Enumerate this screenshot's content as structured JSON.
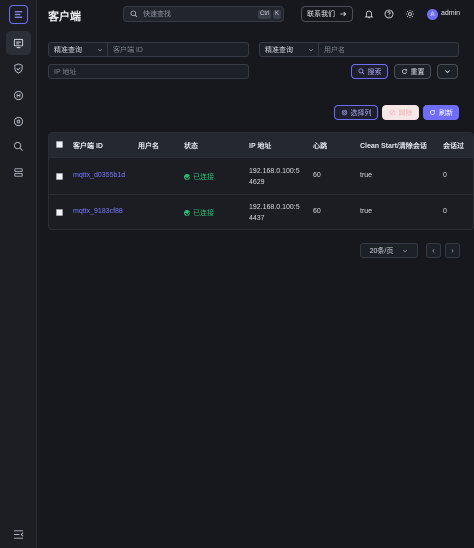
{
  "header": {
    "title": "客户端",
    "search_placeholder": "快速查找",
    "shortcut_key1": "Ctrl",
    "shortcut_key2": "K",
    "contact_label": "联系我们",
    "user_initial": "A",
    "user_name": "admin"
  },
  "filters": {
    "client_mode": "精准查询",
    "client_placeholder": "客户端 ID",
    "user_mode": "精准查询",
    "user_placeholder": "用户名",
    "ip_placeholder": "IP 地址",
    "search_label": "搜索",
    "reset_label": "重置"
  },
  "toolbar": {
    "columns_label": "选择列",
    "clear_label": "踢除",
    "refresh_label": "刷新"
  },
  "table": {
    "columns": [
      "客户端 ID",
      "用户名",
      "状态",
      "IP 地址",
      "心跳",
      "Clean Start/清除会话",
      "会话过"
    ],
    "rows": [
      {
        "client_id": "mqttx_d0355b1d",
        "username": "",
        "status": "已连接",
        "ip_line1": "192.168.0.100:5",
        "ip_line2": "4629",
        "keepalive": "60",
        "clean_start": "true",
        "session": "0"
      },
      {
        "client_id": "mqttx_9183cf88",
        "username": "",
        "status": "已连接",
        "ip_line1": "192.168.0.100:5",
        "ip_line2": "4437",
        "keepalive": "60",
        "clean_start": "true",
        "session": "0"
      }
    ]
  },
  "pagination": {
    "page_size_label": "20条/页",
    "prev": "‹",
    "next": "›"
  },
  "colors": {
    "accent": "#6f6cf7",
    "success": "#27c276",
    "background": "#16181d"
  }
}
